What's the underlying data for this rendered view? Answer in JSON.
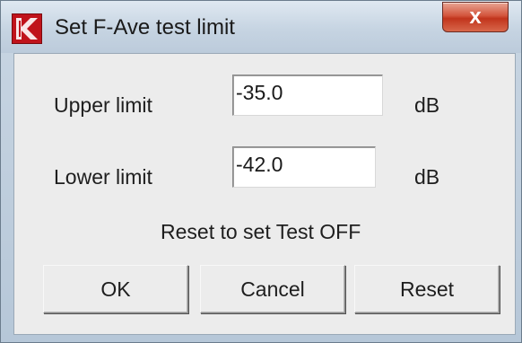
{
  "window": {
    "title": "Set F-Ave test limit",
    "close_symbol": "x",
    "app_icon": "app-logo-icon"
  },
  "form": {
    "upper": {
      "label": "Upper limit",
      "value": "-35.0",
      "unit": "dB"
    },
    "lower": {
      "label": "Lower limit",
      "value": "-42.0",
      "unit": "dB"
    },
    "hint": "Reset to set Test OFF"
  },
  "buttons": {
    "ok": "OK",
    "cancel": "Cancel",
    "reset": "Reset"
  },
  "colors": {
    "app_icon": "#c0131b",
    "close_button": "#c1341c"
  }
}
